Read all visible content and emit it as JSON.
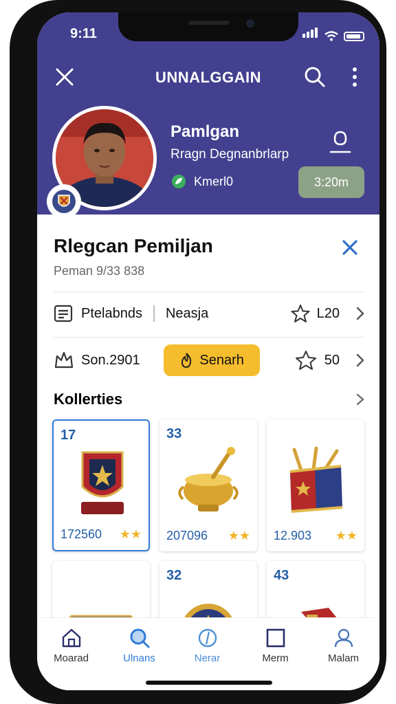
{
  "status_bar": {
    "time": "9:11"
  },
  "nav": {
    "title": "UNNALGGAIN"
  },
  "profile": {
    "name": "Pamlgan",
    "subtitle": "Rragn Degnanbrlarp",
    "meta": "Kmerl0",
    "timer": "3:20m"
  },
  "section": {
    "title": "Rlegcan Pemiljan",
    "subtitle": "Peman 9/33 838"
  },
  "row1": {
    "left_label": "Ptelabnds",
    "mid_label": "Neasja",
    "count": "L20"
  },
  "row2": {
    "left_label": "Son.2901",
    "button_label": "Senarh",
    "count": "50"
  },
  "collection": {
    "title": "Kollerties",
    "cards": [
      {
        "num": "17",
        "price": "172560",
        "art": "shield-trophy",
        "rating": 2
      },
      {
        "num": "33",
        "price": "207096",
        "art": "golden-urn",
        "rating": 2
      },
      {
        "num": "",
        "price": "12.903",
        "art": "scroll-chest",
        "rating": 2
      },
      {
        "num": "",
        "price": "",
        "art": "red-chest",
        "rating": 0
      },
      {
        "num": "32",
        "price": "",
        "art": "star-medal",
        "rating": 0
      },
      {
        "num": "43",
        "price": "",
        "art": "banner-box",
        "rating": 0
      }
    ]
  },
  "tabs": [
    {
      "label": "Moarad",
      "icon": "home-icon"
    },
    {
      "label": "Ulnans",
      "icon": "search-icon"
    },
    {
      "label": "Nerar",
      "icon": "compass-icon"
    },
    {
      "label": "Merm",
      "icon": "square-icon"
    },
    {
      "label": "Malam",
      "icon": "user-icon"
    }
  ],
  "colors": {
    "header_bg": "#43408f",
    "accent_blue": "#245ea8",
    "search_yellow": "#f5bd2d",
    "timer_green": "#8ca287",
    "star_gold": "#f1b52a"
  }
}
